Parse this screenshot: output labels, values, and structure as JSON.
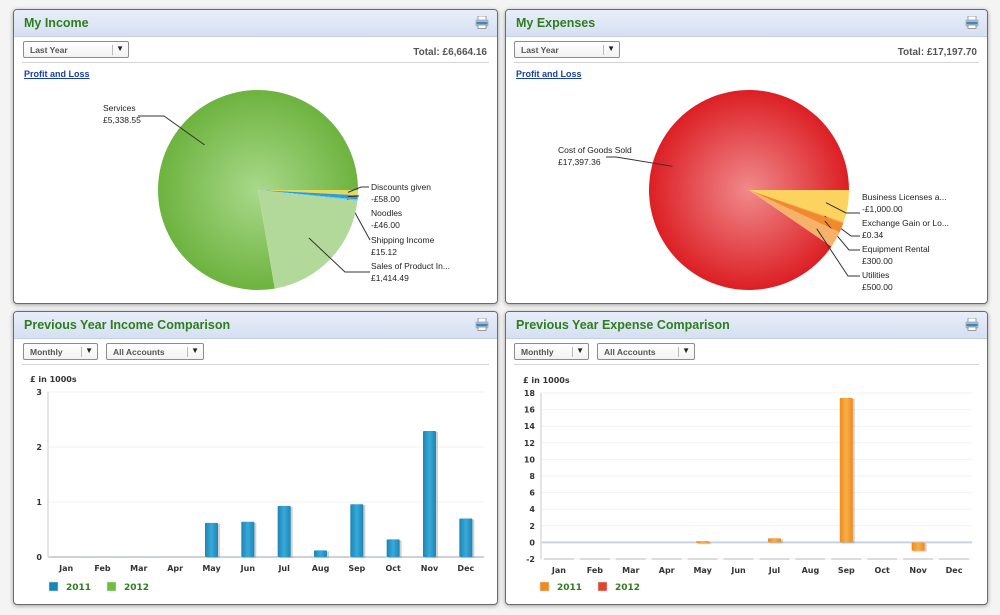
{
  "income": {
    "title": "My Income",
    "period": "Last Year",
    "total": "Total: £6,664.16",
    "link": "Profit and Loss",
    "slices": [
      {
        "label": "Services",
        "value": "£5,338.55",
        "amount": 5338.55,
        "color": "#7ab648"
      },
      {
        "label": "Discounts given",
        "value": "-£58.00",
        "amount": 58.0,
        "color": "#e3d95a"
      },
      {
        "label": "Noodles",
        "value": "-£46.00",
        "amount": 46.0,
        "color": "#2a9fd6"
      },
      {
        "label": "Shipping Income",
        "value": "£15.12",
        "amount": 15.12,
        "color": "#6cc4ea"
      },
      {
        "label": "Sales of Product In...",
        "value": "£1,414.49",
        "amount": 1414.49,
        "color": "#b3d99a"
      }
    ]
  },
  "expenses": {
    "title": "My Expenses",
    "period": "Last Year",
    "total": "Total: £17,197.70",
    "link": "Profit and Loss",
    "slices": [
      {
        "label": "Cost of Goods Sold",
        "value": "£17,397.36",
        "amount": 17397.36,
        "color": "#dc1f24"
      },
      {
        "label": "Business Licenses a...",
        "value": "-£1,000.00",
        "amount": 1000.0,
        "color": "#fdd35f"
      },
      {
        "label": "Exchange Gain or Lo...",
        "value": "£0.34",
        "amount": 0.34,
        "color": "#f7a940"
      },
      {
        "label": "Equipment Rental",
        "value": "£300.00",
        "amount": 300.0,
        "color": "#f08a2c"
      },
      {
        "label": "Utilities",
        "value": "£500.00",
        "amount": 500.0,
        "color": "#f6b26b"
      }
    ]
  },
  "income_comparison": {
    "title": "Previous Year Income Comparison",
    "frequency": "Monthly",
    "accounts": "All Accounts"
  },
  "expense_comparison": {
    "title": "Previous Year Expense Comparison",
    "frequency": "Monthly",
    "accounts": "All Accounts"
  },
  "chart_data": [
    {
      "type": "pie",
      "title": "My Income",
      "categories": [
        "Services",
        "Discounts given",
        "Noodles",
        "Shipping Income",
        "Sales of Product In..."
      ],
      "values": [
        5338.55,
        -58.0,
        -46.0,
        15.12,
        1414.49
      ],
      "labels": [
        "£5,338.55",
        "-£58.00",
        "-£46.00",
        "£15.12",
        "£1,414.49"
      ]
    },
    {
      "type": "pie",
      "title": "My Expenses",
      "categories": [
        "Cost of Goods Sold",
        "Business Licenses a...",
        "Exchange Gain or Lo...",
        "Equipment Rental",
        "Utilities"
      ],
      "values": [
        17397.36,
        -1000.0,
        0.34,
        300.0,
        500.0
      ],
      "labels": [
        "£17,397.36",
        "-£1,000.00",
        "£0.34",
        "£300.00",
        "£500.00"
      ]
    },
    {
      "type": "bar",
      "title": "Previous Year Income Comparison",
      "ylabel": "£ in 1000s",
      "categories": [
        "Jan",
        "Feb",
        "Mar",
        "Apr",
        "May",
        "Jun",
        "Jul",
        "Aug",
        "Sep",
        "Oct",
        "Nov",
        "Dec"
      ],
      "series": [
        {
          "name": "2011",
          "color": "#1a86b8",
          "values": [
            0,
            0,
            0,
            0,
            0.62,
            0.64,
            0.93,
            0.12,
            0.96,
            0.32,
            2.29,
            0.7
          ]
        },
        {
          "name": "2012",
          "color": "#6cbf3f",
          "values": [
            0,
            0,
            0,
            0,
            0,
            0,
            0,
            0,
            0,
            0,
            0,
            0
          ]
        }
      ],
      "ylim": [
        0,
        3
      ],
      "yticks": [
        0,
        1,
        2,
        3
      ],
      "grid": true,
      "legend": "bottom-left"
    },
    {
      "type": "bar",
      "title": "Previous Year Expense Comparison",
      "ylabel": "£ in 1000s",
      "categories": [
        "Jan",
        "Feb",
        "Mar",
        "Apr",
        "May",
        "Jun",
        "Jul",
        "Aug",
        "Sep",
        "Oct",
        "Nov",
        "Dec"
      ],
      "series": [
        {
          "name": "2011",
          "color": "#f08a1c",
          "values": [
            0,
            0,
            0,
            0,
            0.15,
            0,
            0.5,
            0,
            17.4,
            0,
            -1.0,
            0
          ]
        },
        {
          "name": "2012",
          "color": "#e0452a",
          "values": [
            0,
            0,
            0,
            0,
            0,
            0,
            0,
            0,
            0,
            0,
            0,
            0
          ]
        }
      ],
      "ylim": [
        -2,
        18
      ],
      "yticks": [
        -2,
        0,
        2,
        4,
        6,
        8,
        10,
        12,
        14,
        16,
        18
      ],
      "grid": true,
      "legend": "bottom-left"
    }
  ]
}
